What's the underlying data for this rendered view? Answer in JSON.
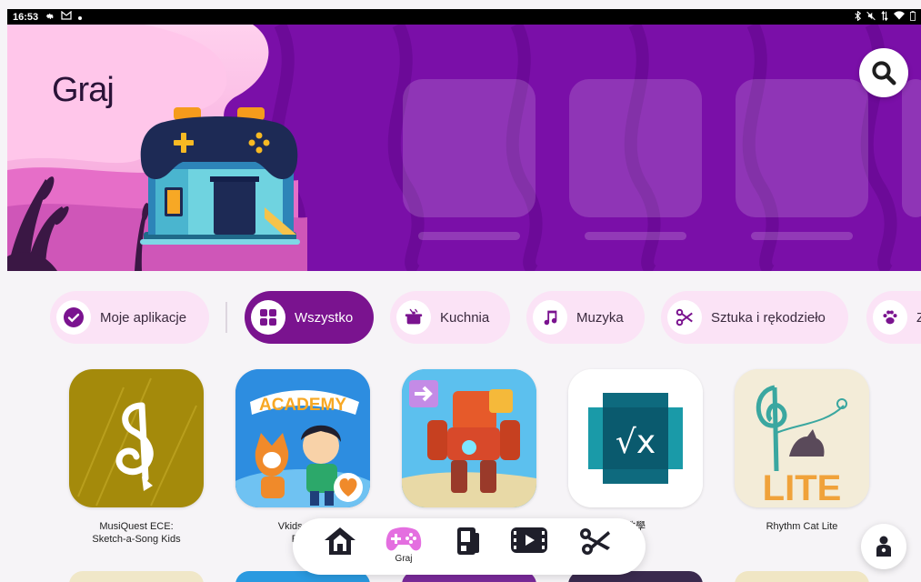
{
  "status_bar": {
    "time": "16:53",
    "icons_left": [
      "gear-icon",
      "gmail-icon",
      "dot-icon"
    ],
    "icons_right": [
      "bluetooth-icon",
      "mute-icon",
      "data-icon",
      "wifi-icon",
      "battery-icon"
    ]
  },
  "hero": {
    "title": "Graj",
    "search_icon": "search-icon"
  },
  "chips": [
    {
      "label": "Moje aplikacje",
      "icon": "check-circle-icon",
      "active": false
    },
    {
      "label": "Wszystko",
      "icon": "grid-icon",
      "active": true
    },
    {
      "label": "Kuchnia",
      "icon": "pot-icon",
      "active": false
    },
    {
      "label": "Muzyka",
      "icon": "music-note-icon",
      "active": false
    },
    {
      "label": "Sztuka i rękodzieło",
      "icon": "scissors-icon",
      "active": false
    },
    {
      "label": "Z",
      "icon": "paw-icon",
      "active": false
    }
  ],
  "apps": [
    {
      "name": "MusiQuest ECE:\nSketch-a-Song Kids",
      "color": "#a48a0b",
      "icon": "treble-clef-pencil-icon"
    },
    {
      "name": "Vkids Acad\nEngli",
      "color": "#2d8de0",
      "icon": "academy-kids-icon",
      "tile_text": "ACADEMY"
    },
    {
      "name": "",
      "color": "#3aa8e6",
      "icon": "robot-icon"
    },
    {
      "name": "教學",
      "color": "#ffffff",
      "icon": "square-root-x-icon",
      "tile_text": "√x"
    },
    {
      "name": "Rhythm Cat Lite",
      "color": "#f3ecd8",
      "icon": "cat-treble-clef-icon",
      "tile_text": "LITE"
    }
  ],
  "bottom_nav": {
    "items": [
      {
        "id": "home",
        "icon": "house-icon",
        "label": ""
      },
      {
        "id": "play",
        "icon": "gamepad-icon",
        "label": "Graj",
        "active": true
      },
      {
        "id": "read",
        "icon": "book-icon",
        "label": ""
      },
      {
        "id": "watch",
        "icon": "video-icon",
        "label": ""
      },
      {
        "id": "create",
        "icon": "scissors-icon",
        "label": ""
      }
    ]
  },
  "kid_profile_icon": "kid-profile-icon",
  "colors": {
    "hero_purple": "#7a0fa8",
    "chip_active": "#7a138f",
    "chip_inactive": "#fbe3f6"
  }
}
